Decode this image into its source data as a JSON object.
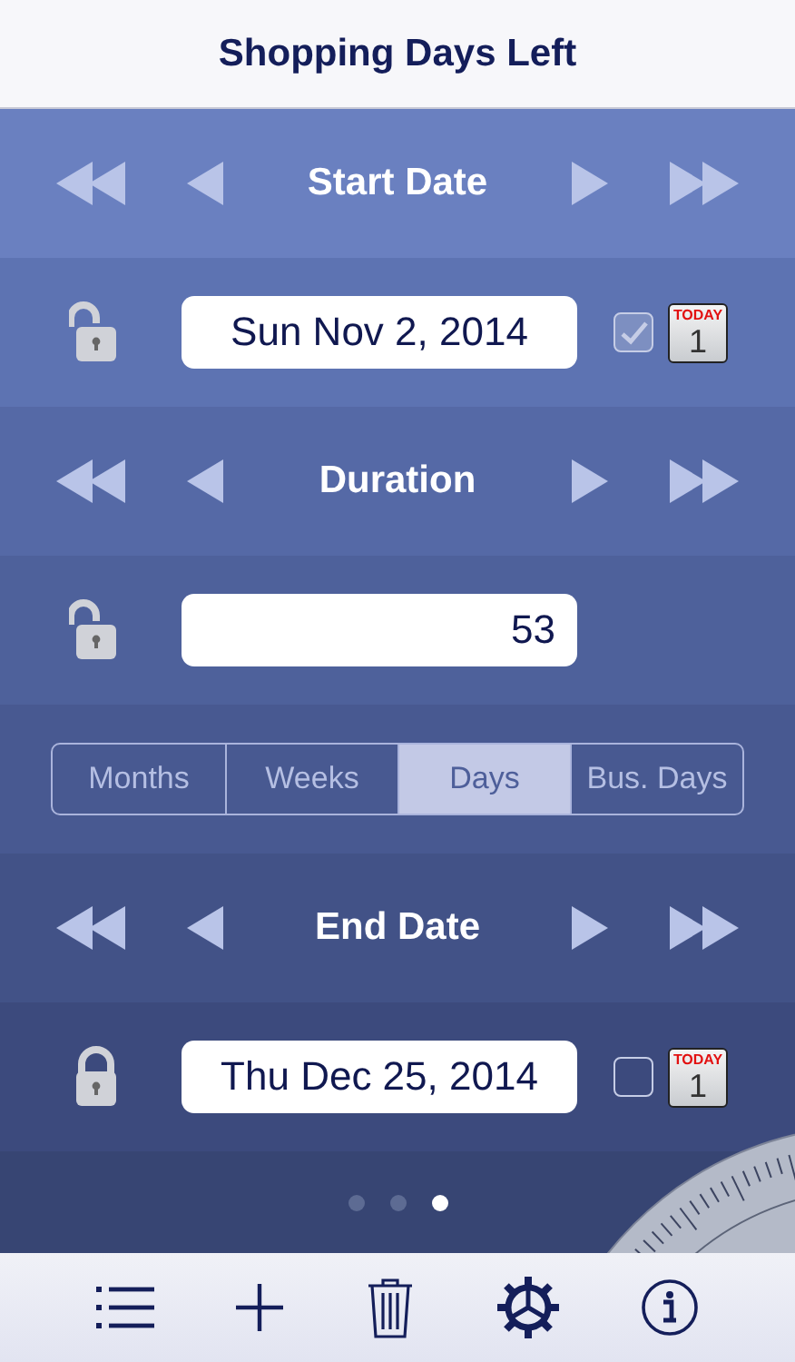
{
  "title": "Shopping Days Left",
  "sections": [
    {
      "kind": "nav",
      "label": "Start Date"
    },
    {
      "kind": "date",
      "locked": false,
      "value": "Sun Nov 2, 2014",
      "checked": true,
      "today_label": "TODAY",
      "today_day": "1"
    },
    {
      "kind": "nav",
      "label": "Duration"
    },
    {
      "kind": "number",
      "locked": false,
      "value": "53"
    },
    {
      "kind": "segments",
      "items": [
        {
          "label": "Months",
          "selected": false
        },
        {
          "label": "Weeks",
          "selected": false
        },
        {
          "label": "Days",
          "selected": true
        },
        {
          "label": "Bus. Days",
          "selected": false
        }
      ]
    },
    {
      "kind": "nav",
      "label": "End Date"
    },
    {
      "kind": "date",
      "locked": true,
      "value": "Thu Dec 25, 2014",
      "checked": false,
      "today_label": "TODAY",
      "today_day": "1"
    }
  ],
  "pages": [
    {
      "selected": false
    },
    {
      "selected": false
    },
    {
      "selected": true
    }
  ]
}
